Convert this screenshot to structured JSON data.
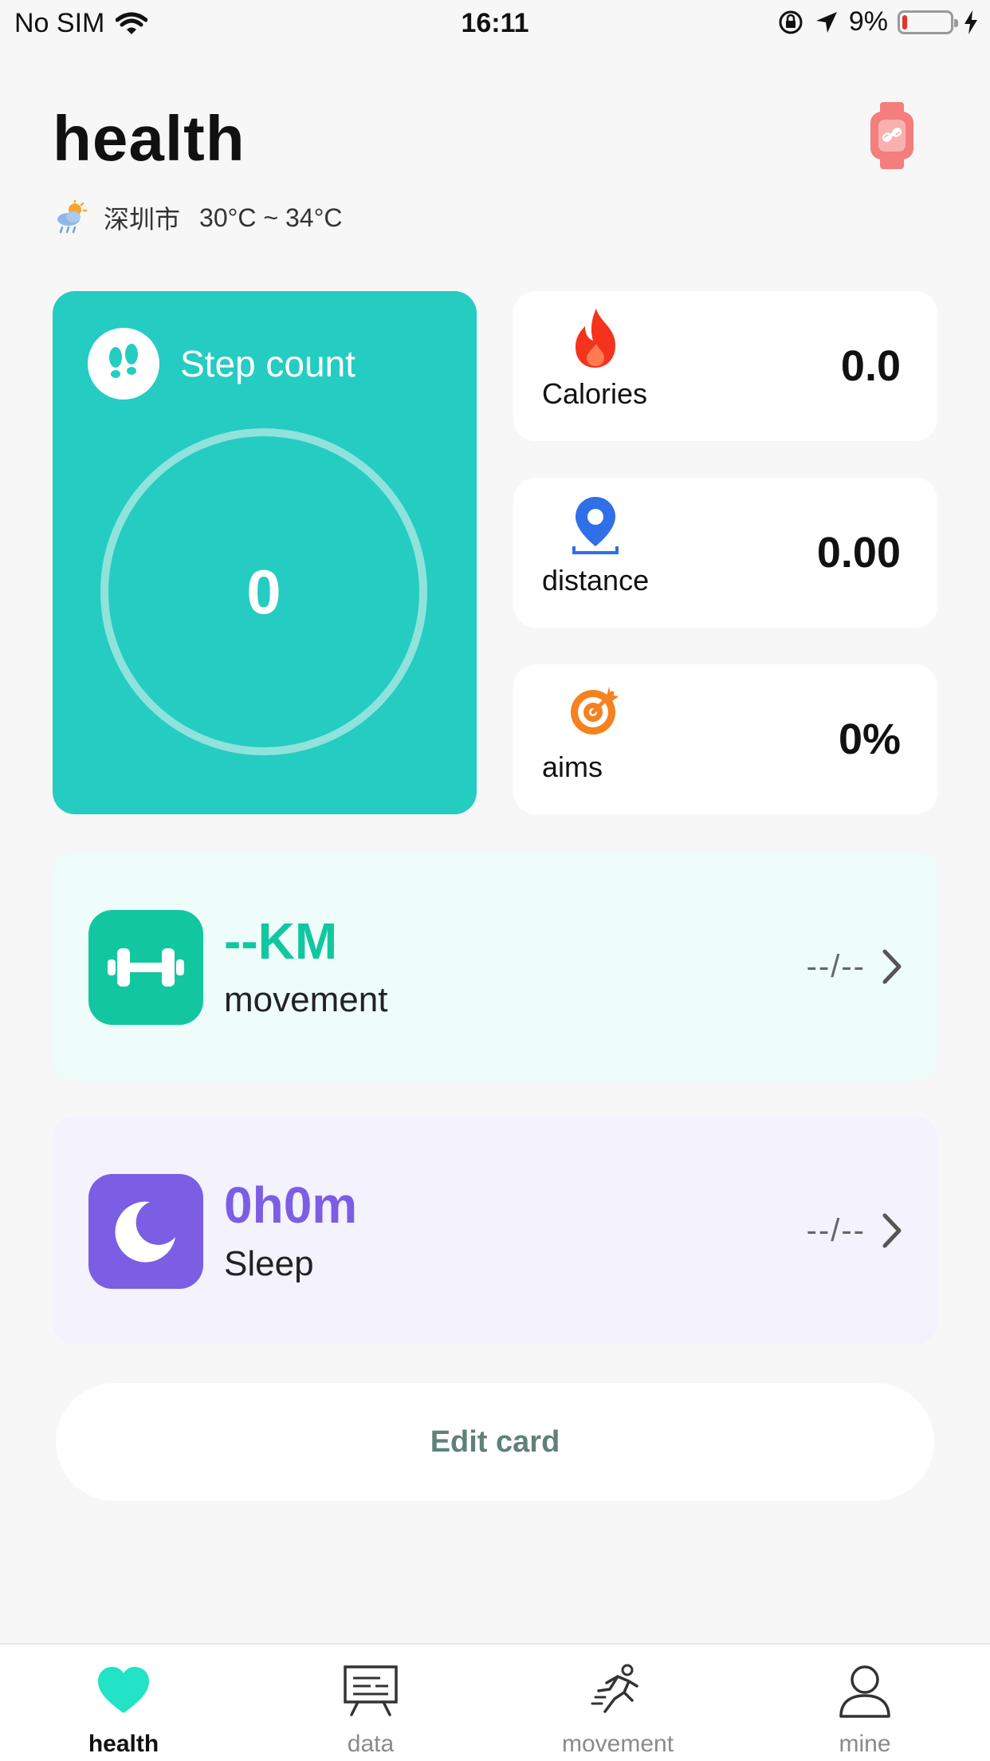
{
  "status_bar": {
    "carrier": "No SIM",
    "time": "16:11",
    "battery": "9%",
    "battery_level": 0.09
  },
  "header": {
    "title": "health",
    "device_icon": "watch-link-icon"
  },
  "weather": {
    "icon": "weather-rain-sun-icon",
    "city": "深圳市",
    "temperature": "30°C ~ 34°C"
  },
  "step_card": {
    "label": "Step count",
    "value": "0",
    "icon": "footprints-icon",
    "color": "#25ccc2"
  },
  "stats": [
    {
      "key": "calories",
      "label": "Calories",
      "value": "0.0",
      "icon": "flame-icon",
      "color": "#f5331c"
    },
    {
      "key": "distance",
      "label": "distance",
      "value": "0.00",
      "icon": "location-pin-icon",
      "color": "#2f6fe8"
    },
    {
      "key": "aims",
      "label": "aims",
      "value": "0%",
      "icon": "target-icon",
      "color": "#f5821f"
    }
  ],
  "movement_card": {
    "value": "--KM",
    "label": "movement",
    "date": "--/--",
    "icon": "dumbbell-icon",
    "accent": "#12c7a0",
    "background": "#effdfa"
  },
  "sleep_card": {
    "value": "0h0m",
    "label": "Sleep",
    "date": "--/--",
    "icon": "moon-icon",
    "accent": "#7b5ee3",
    "background": "#f3f2fd"
  },
  "edit_button": {
    "label": "Edit card"
  },
  "tabbar": {
    "items": [
      {
        "label": "health",
        "icon": "heart-icon",
        "active": true
      },
      {
        "label": "data",
        "icon": "presentation-board-icon",
        "active": false
      },
      {
        "label": "movement",
        "icon": "runner-icon",
        "active": false
      },
      {
        "label": "mine",
        "icon": "person-icon",
        "active": false
      }
    ]
  }
}
